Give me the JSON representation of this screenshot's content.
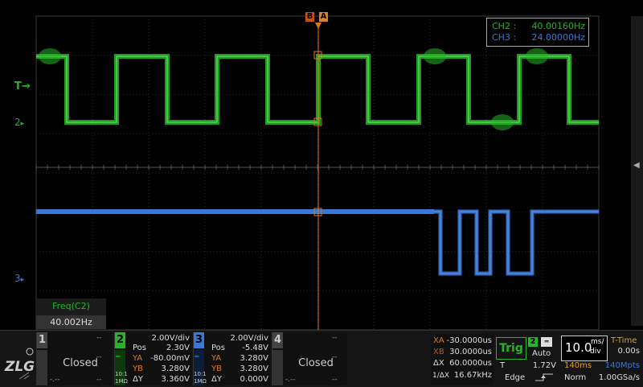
{
  "markers": {
    "b": "B",
    "a": "A"
  },
  "channel_labels": {
    "trigger": "T",
    "ch2": "2",
    "ch3": "3"
  },
  "freq_box": {
    "rows": [
      {
        "label": "CH2 :",
        "value": "40.00160Hz",
        "color": "#26b526"
      },
      {
        "label": "CH3 :",
        "value": "24.00000Hz",
        "color": "#3a78d8"
      }
    ]
  },
  "measurement": {
    "label": "Freq(C2)",
    "value": "40.002Hz"
  },
  "channels": {
    "ch1": {
      "num": "1",
      "status": "Closed",
      "dash1": "--",
      "dash2": "--",
      "dash3": "-.--"
    },
    "ch2": {
      "num": "2",
      "scale": "2.00V/div",
      "pos_label": "Pos",
      "pos": "2.30V",
      "ya_label": "YA",
      "ya": "-80.00mV",
      "yb_label": "YB",
      "yb": "3.280V",
      "dy_label": "ΔY",
      "dy": "3.360V",
      "probe": "10:1",
      "imp": "1MΩ",
      "color": "#26b526"
    },
    "ch3": {
      "num": "3",
      "scale": "2.00V/div",
      "pos_label": "Pos",
      "pos": "-5.48V",
      "ya_label": "YA",
      "ya": "3.280V",
      "yb_label": "YB",
      "yb": "3.280V",
      "dy_label": "ΔY",
      "dy": "0.000V",
      "probe": "10:1",
      "imp": "1MΩ",
      "color": "#3a78d8"
    },
    "ch4": {
      "num": "4",
      "status": "Closed",
      "dash1": "--",
      "dash2": "--",
      "dash3": "-.--"
    }
  },
  "cursors": {
    "xa_label": "XA",
    "xa": "-30.0000us",
    "xb_label": "XB",
    "xb": "30.0000us",
    "dx_label": "ΔX",
    "dx": "60.0000us",
    "inv_label": "1/ΔX",
    "inv": "16.67kHz"
  },
  "trigger": {
    "label": "Trig",
    "source": "2",
    "mode": "Auto",
    "t_label": "T",
    "level": "1.72V",
    "type": "Edge"
  },
  "timebase": {
    "value": "10.0",
    "unit_top": "ms/",
    "unit_bottom": "div",
    "mode": "T-Time",
    "offset": "0.00s",
    "window": "140ms",
    "depth": "140Mpts",
    "acq": "Norm",
    "rate": "1.00GSa/s"
  }
}
